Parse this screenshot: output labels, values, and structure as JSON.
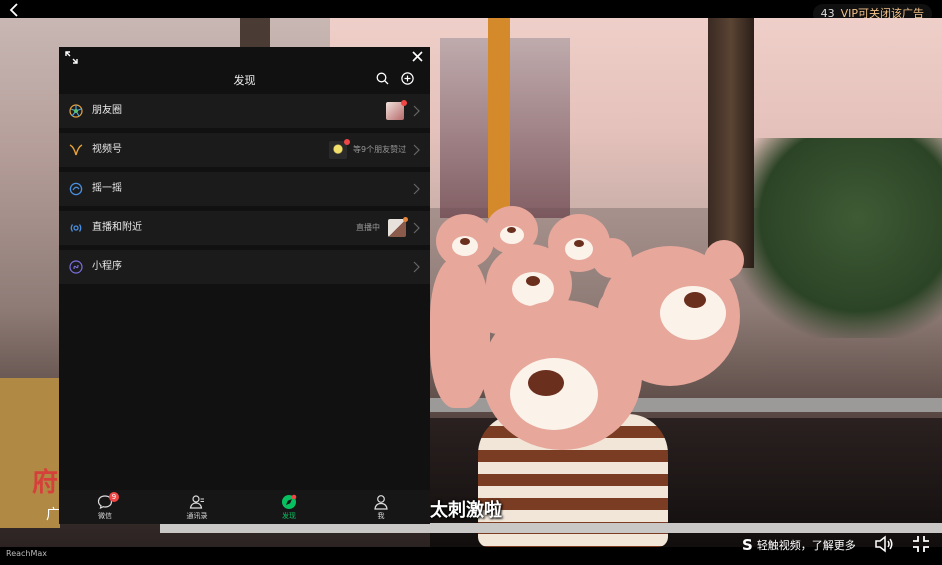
{
  "topbar": {
    "ad_count": "43",
    "ad_text": "VIP可关闭该广告"
  },
  "video": {
    "subtitle": "太刺激啦",
    "side_red_text": "府",
    "side_white_text": "广"
  },
  "bottombar": {
    "brand": "ReachMax",
    "touch_text": "轻触视频，了解更多",
    "touch_glyph": "S"
  },
  "panel": {
    "title": "发现",
    "rows": [
      {
        "label": "朋友圈",
        "icon": "moments-icon",
        "right_text": ""
      },
      {
        "label": "视频号",
        "icon": "channels-icon",
        "right_text": "等9个朋友赞过"
      },
      {
        "label": "摇一摇",
        "icon": "shake-icon",
        "right_text": ""
      },
      {
        "label": "直播和附近",
        "icon": "live-nearby-icon",
        "right_text": "直播中"
      },
      {
        "label": "小程序",
        "icon": "mini-program-icon",
        "right_text": ""
      }
    ],
    "tabs": [
      {
        "label": "微信",
        "icon": "chat-icon",
        "badge": "9"
      },
      {
        "label": "通讯录",
        "icon": "contacts-icon",
        "badge": ""
      },
      {
        "label": "发现",
        "icon": "discover-icon",
        "badge": ""
      },
      {
        "label": "我",
        "icon": "me-icon",
        "badge": ""
      }
    ]
  },
  "colors": {
    "accent": "#07c160",
    "badge": "#f04646",
    "ad_text": "#f2c28a"
  }
}
